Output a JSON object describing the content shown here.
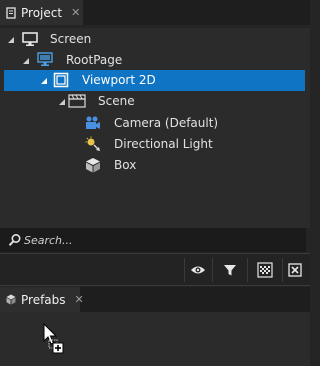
{
  "project_tab": {
    "label": "Project",
    "close": "✕"
  },
  "tree": {
    "items": [
      {
        "label": "Screen"
      },
      {
        "label": "RootPage"
      },
      {
        "label": "Viewport 2D"
      },
      {
        "label": "Scene"
      },
      {
        "label": "Camera (Default)"
      },
      {
        "label": "Directional Light"
      },
      {
        "label": "Box"
      }
    ]
  },
  "search": {
    "placeholder": "Search..."
  },
  "prefabs_tab": {
    "label": "Prefabs",
    "close": "✕"
  },
  "colors": {
    "selection": "#1074c4",
    "camera_icon": "#4a90e2",
    "light_icon": "#e8c34a"
  }
}
